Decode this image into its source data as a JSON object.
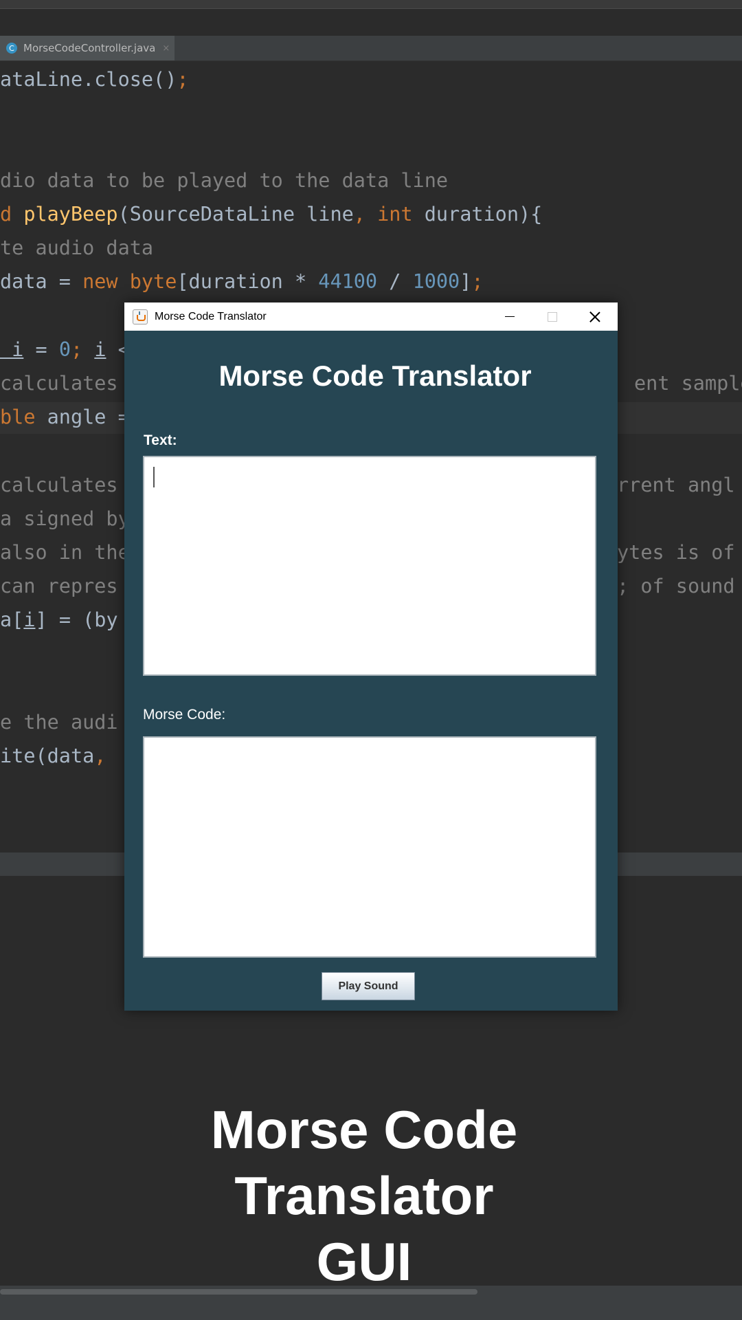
{
  "ide": {
    "tab_label": "MorseCodeController.java",
    "tab_icon": "C",
    "tab_close": "×",
    "code_lines": [
      {
        "id": "l1",
        "parts": [
          [
            "",
            "ataLine.close()"
          ],
          [
            "k",
            ";"
          ]
        ]
      },
      {
        "id": "l2",
        "parts": [
          [
            "c",
            "dio data to be played to the data line"
          ]
        ]
      },
      {
        "id": "l3",
        "parts": [
          [
            "k",
            "d "
          ],
          [
            "f",
            "playBeep"
          ],
          [
            "",
            "(SourceDataLine line"
          ],
          [
            "k",
            ", int "
          ],
          [
            "",
            "duration){"
          ]
        ]
      },
      {
        "id": "l4",
        "parts": [
          [
            "c",
            "te audio data"
          ]
        ]
      },
      {
        "id": "l5",
        "parts": [
          [
            "",
            "data = "
          ],
          [
            "k",
            "new byte"
          ],
          [
            "",
            "[duration * "
          ],
          [
            "n",
            "44100"
          ],
          [
            "",
            " / "
          ],
          [
            "n",
            "1000"
          ],
          [
            "",
            "]"
          ],
          [
            "k",
            ";"
          ]
        ]
      },
      {
        "id": "l6",
        "parts": [
          [
            "u",
            " i"
          ],
          [
            "",
            " = "
          ],
          [
            "n",
            "0"
          ],
          [
            "k",
            "; "
          ],
          [
            "u",
            "i"
          ],
          [
            "",
            " <"
          ]
        ]
      },
      {
        "id": "l7",
        "parts": [
          [
            "c",
            "calculates"
          ]
        ]
      },
      {
        "id": "l8",
        "parts": [
          [
            "k",
            "ble "
          ],
          [
            "",
            "angle ="
          ]
        ]
      },
      {
        "id": "l9",
        "parts": [
          [
            "c",
            "calculates"
          ]
        ]
      },
      {
        "id": "l10",
        "parts": [
          [
            "c",
            "a signed by"
          ]
        ]
      },
      {
        "id": "l11",
        "parts": [
          [
            "c",
            "also in the"
          ]
        ]
      },
      {
        "id": "l12",
        "parts": [
          [
            "c",
            "can repres"
          ]
        ]
      },
      {
        "id": "l13",
        "parts": [
          [
            "",
            "a["
          ],
          [
            "u",
            "i"
          ],
          [
            "",
            "] = (by"
          ]
        ]
      },
      {
        "id": "l14",
        "parts": [
          [
            "c",
            "e the audi"
          ]
        ]
      },
      {
        "id": "l15",
        "parts": [
          [
            "",
            "ite(data"
          ],
          [
            "k",
            ", "
          ]
        ]
      }
    ],
    "right_fragments": [
      {
        "id": "r1",
        "text": "ent sample"
      },
      {
        "id": "r2",
        "text": "rrent angl"
      },
      {
        "id": "r3",
        "text": "ytes is of"
      },
      {
        "id": "r4",
        "text": "; of sound"
      }
    ]
  },
  "window": {
    "title": "Morse Code Translator",
    "app_title": "Morse Code Translator",
    "text_label": "Text:",
    "text_value": "",
    "morse_label": "Morse Code:",
    "morse_value": "",
    "play_button": "Play Sound"
  },
  "caption": {
    "line1": "Morse Code",
    "line2": "Translator",
    "line3": "GUI"
  },
  "colors": {
    "app_background": "#264653",
    "ide_background": "#2b2b2b",
    "keyword": "#cc7832",
    "number": "#6897bb",
    "comment": "#808080",
    "method": "#ffc66d"
  }
}
